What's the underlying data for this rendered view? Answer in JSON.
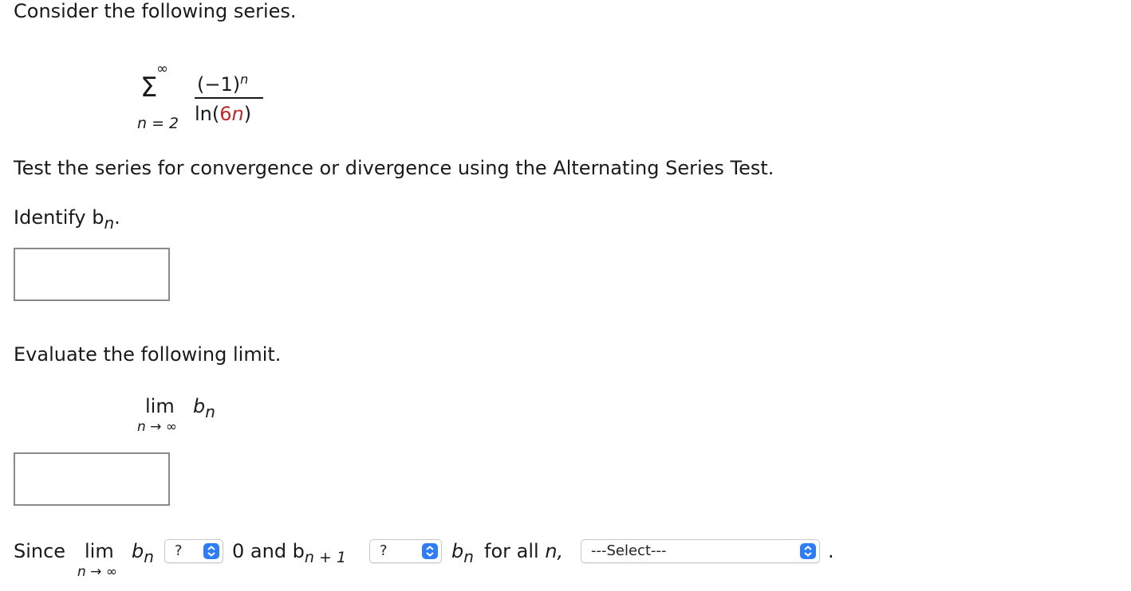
{
  "intro": "Consider the following series.",
  "series": {
    "sum_upper": "∞",
    "sum_symbol": "Σ",
    "sum_lower": "n = 2",
    "numerator": "(−1)",
    "numerator_exp": "n",
    "denominator_prefix": "ln(",
    "denominator_coef": "6",
    "denominator_var": "n",
    "denominator_suffix": ")"
  },
  "instruction": "Test the series for convergence or divergence using the Alternating Series Test.",
  "identify": {
    "text": "Identify b",
    "sub": "n",
    "end": "."
  },
  "bn_answer": "",
  "evaluate": "Evaluate the following limit.",
  "limit": {
    "lim": "lim",
    "under": "n → ∞",
    "b": "b",
    "sub": "n"
  },
  "limit_answer": "",
  "since": {
    "since": "Since",
    "lim": "lim",
    "under": "n → ∞",
    "b": "b",
    "sub": "n",
    "zero_and": "0 and b",
    "sub2": "n + 1",
    "b2": "b",
    "sub3": "n",
    "for_all": "for all",
    "n": "n,",
    "period": "."
  },
  "selects": {
    "compare1": "?",
    "compare2": "?",
    "conclusion": "---Select---"
  },
  "colors": {
    "accent": "#2f7df6",
    "highlight": "#c0272d"
  }
}
